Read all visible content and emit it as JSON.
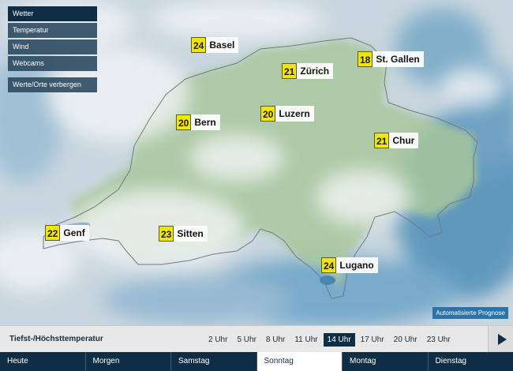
{
  "menu": {
    "items": [
      "Wetter",
      "Temperatur",
      "Wind",
      "Webcams"
    ],
    "hide_label": "Werte/Orte verbergen"
  },
  "cities": [
    {
      "name": "Basel",
      "temp": "24"
    },
    {
      "name": "Zürich",
      "temp": "21"
    },
    {
      "name": "St. Gallen",
      "temp": "18"
    },
    {
      "name": "Luzern",
      "temp": "20"
    },
    {
      "name": "Bern",
      "temp": "20"
    },
    {
      "name": "Chur",
      "temp": "21"
    },
    {
      "name": "Genf",
      "temp": "22"
    },
    {
      "name": "Sitten",
      "temp": "23"
    },
    {
      "name": "Lugano",
      "temp": "24"
    }
  ],
  "badge": "Automatisierte Prognose",
  "timebar": {
    "label": "Tiefst-/Höchsttemperatur",
    "times": [
      "2 Uhr",
      "5 Uhr",
      "8 Uhr",
      "11 Uhr",
      "14 Uhr",
      "17 Uhr",
      "20 Uhr",
      "23 Uhr"
    ],
    "selected": "14 Uhr"
  },
  "days": [
    "Heute",
    "Morgen",
    "Samstag",
    "Sonntag",
    "Montag",
    "Dienstag"
  ],
  "selected_day": "Sonntag",
  "colors": {
    "dark": "#0f2d44",
    "temp_badge": "#f2e600",
    "badge_blue": "#2a72a8"
  }
}
